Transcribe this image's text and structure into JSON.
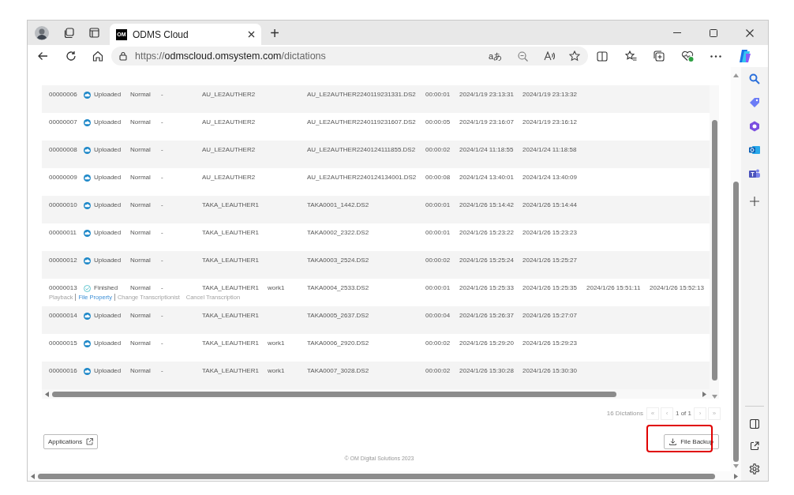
{
  "browser": {
    "tab": {
      "logo": "OM",
      "title": "ODMS Cloud",
      "selected": true
    },
    "new_tab": "+",
    "url": {
      "scheme": "https://",
      "host": "odmscloud.omsystem.com",
      "path": "/dictations"
    },
    "translate": "aあ"
  },
  "table": {
    "rows": [
      {
        "id": "00000006",
        "status": {
          "kind": "uploaded",
          "label": "Uploaded"
        },
        "priority": "Normal",
        "column_4": "-",
        "author": "AU_LE2AUTHER2",
        "file_name": "AU_LE2AUTHER2240119231331.DS2",
        "duration": "00:00:01",
        "column_9": "2024/1/19 23:13:31",
        "column_10": "2024/1/19 23:13:32"
      },
      {
        "id": "00000007",
        "status": {
          "kind": "uploaded",
          "label": "Uploaded"
        },
        "priority": "Normal",
        "column_4": "-",
        "author": "AU_LE2AUTHER2",
        "file_name": "AU_LE2AUTHER2240119231607.DS2",
        "duration": "00:00:05",
        "column_9": "2024/1/19 23:16:07",
        "column_10": "2024/1/19 23:16:12"
      },
      {
        "id": "00000008",
        "status": {
          "kind": "uploaded",
          "label": "Uploaded"
        },
        "priority": "Normal",
        "column_4": "-",
        "author": "AU_LE2AUTHER2",
        "file_name": "AU_LE2AUTHER2240124111855.DS2",
        "duration": "00:00:02",
        "column_9": "2024/1/24 11:18:55",
        "column_10": "2024/1/24 11:18:58"
      },
      {
        "id": "00000009",
        "status": {
          "kind": "uploaded",
          "label": "Uploaded"
        },
        "priority": "Normal",
        "column_4": "-",
        "author": "AU_LE2AUTHER2",
        "file_name": "AU_LE2AUTHER2240124134001.DS2",
        "duration": "00:00:08",
        "column_9": "2024/1/24 13:40:01",
        "column_10": "2024/1/24 13:40:09"
      },
      {
        "id": "00000010",
        "status": {
          "kind": "uploaded",
          "label": "Uploaded"
        },
        "priority": "Normal",
        "column_4": "-",
        "author": "TAKA_LEAUTHER1",
        "file_name": "TAKA0001_1442.DS2",
        "duration": "00:00:01",
        "column_9": "2024/1/26 15:14:42",
        "column_10": "2024/1/26 15:14:44"
      },
      {
        "id": "00000011",
        "status": {
          "kind": "uploaded",
          "label": "Uploaded"
        },
        "priority": "Normal",
        "column_4": "-",
        "author": "TAKA_LEAUTHER1",
        "file_name": "TAKA0002_2322.DS2",
        "duration": "00:00:01",
        "column_9": "2024/1/26 15:23:22",
        "column_10": "2024/1/26 15:23:23"
      },
      {
        "id": "00000012",
        "status": {
          "kind": "uploaded",
          "label": "Uploaded"
        },
        "priority": "Normal",
        "column_4": "-",
        "author": "TAKA_LEAUTHER1",
        "file_name": "TAKA0003_2524.DS2",
        "duration": "00:00:02",
        "column_9": "2024/1/26 15:25:24",
        "column_10": "2024/1/26 15:25:27"
      },
      {
        "id": "00000013",
        "status": {
          "kind": "finished",
          "label": "Finished"
        },
        "priority": "Normal",
        "column_4": "-",
        "author": "TAKA_LEAUTHER1",
        "column_6": "work1",
        "file_name": "TAKA0004_2533.DS2",
        "duration": "00:00:01",
        "column_9": "2024/1/26 15:25:33",
        "column_10": "2024/1/26 15:25:35",
        "column_11": "2024/1/26 15:51:11",
        "column_12": "2024/1/26 15:52:13",
        "actions": [
          {
            "label": "Playback",
            "disabled": true
          },
          {
            "label": "File Property",
            "disabled": false
          },
          {
            "label": "Change Transcriptionist",
            "disabled": true
          },
          {
            "label": "Cancel Transcription",
            "disabled": true
          }
        ]
      },
      {
        "id": "00000014",
        "status": {
          "kind": "uploaded",
          "label": "Uploaded"
        },
        "priority": "Normal",
        "column_4": "-",
        "author": "TAKA_LEAUTHER1",
        "file_name": "TAKA0005_2637.DS2",
        "duration": "00:00:04",
        "column_9": "2024/1/26 15:26:37",
        "column_10": "2024/1/26 15:27:07"
      },
      {
        "id": "00000015",
        "status": {
          "kind": "uploaded",
          "label": "Uploaded"
        },
        "priority": "Normal",
        "column_4": "-",
        "author": "TAKA_LEAUTHER1",
        "column_6": "work1",
        "file_name": "TAKA0006_2920.DS2",
        "duration": "00:00:02",
        "column_9": "2024/1/26 15:29:20",
        "column_10": "2024/1/26 15:29:23"
      },
      {
        "id": "00000016",
        "status": {
          "kind": "uploaded",
          "label": "Uploaded"
        },
        "priority": "Normal",
        "column_4": "-",
        "author": "TAKA_LEAUTHER1",
        "column_6": "work1",
        "file_name": "TAKA0007_3028.DS2",
        "duration": "00:00:02",
        "column_9": "2024/1/26 15:30:28",
        "column_10": "2024/1/26 15:30:30"
      }
    ]
  },
  "pagination": {
    "count": "16 Dictations",
    "first": "«",
    "previous": "‹",
    "page": "1 of 1",
    "next": "›",
    "last": "»"
  },
  "applications_button": "Applications",
  "file_backup_button": "File Backup",
  "footer": "© OM Digital Solutions 2023"
}
